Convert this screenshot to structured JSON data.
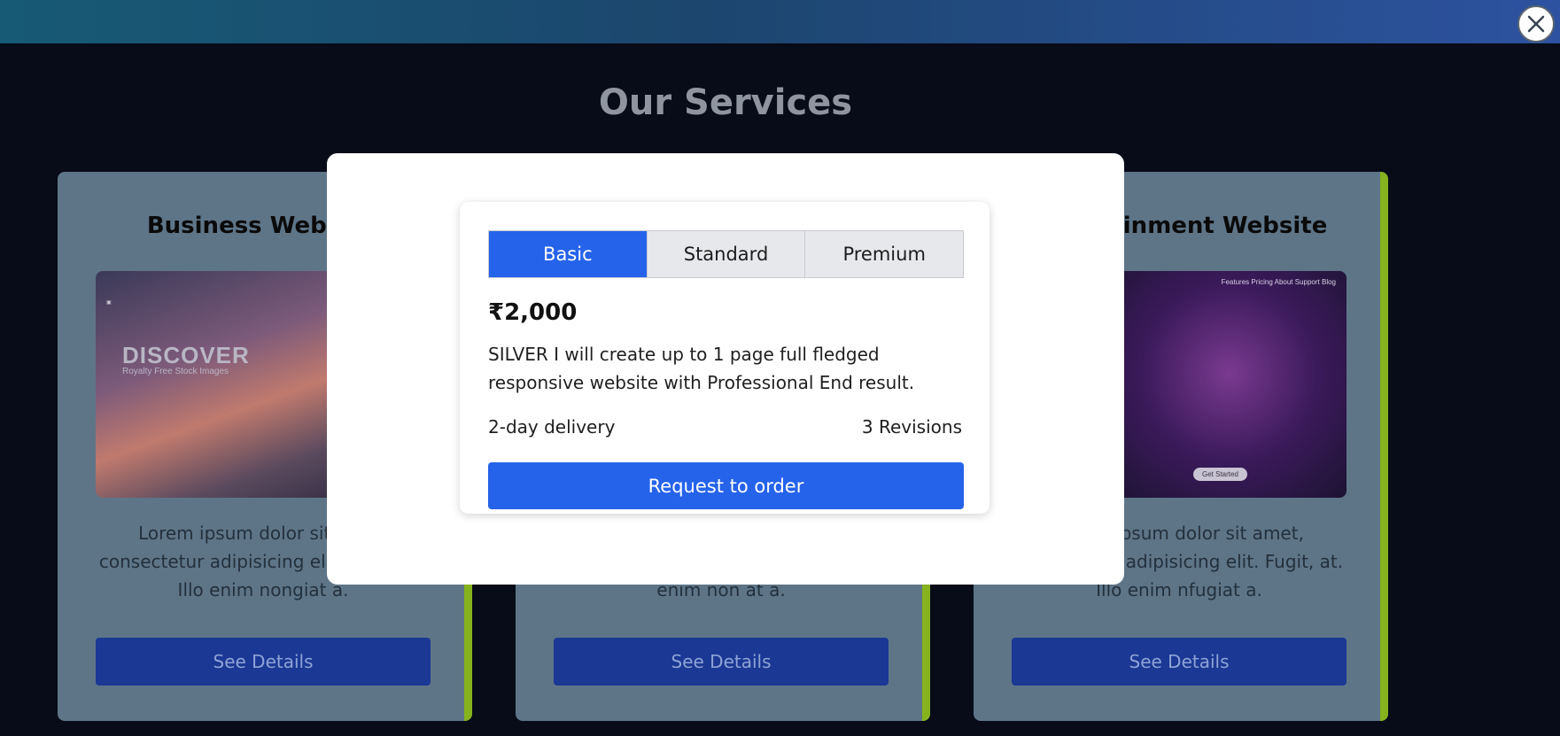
{
  "page": {
    "title": "Our Services"
  },
  "cards": [
    {
      "title": "Business Website",
      "description": "Lorem ipsum dolor sit amet, consectetur adipisicing elit. Fugit, at. Illo enim nongiat a.",
      "image_text": "DISCOVER",
      "image_subtext": "Royalty Free Stock Images",
      "button": "See Details"
    },
    {
      "title": "",
      "description": "enim non at a.",
      "button": "See Details"
    },
    {
      "title": "Entertainment Website",
      "description": "Lorem ipsum dolor sit amet, consectetur adipisicing elit. Fugit, at. Illo enim nfugiat a.",
      "image_nav": "Features  Pricing  About  Support  Blog",
      "image_cta": "Get Started",
      "button": "See Details"
    }
  ],
  "modal": {
    "tabs": [
      {
        "label": "Basic",
        "active": true
      },
      {
        "label": "Standard",
        "active": false
      },
      {
        "label": "Premium",
        "active": false
      }
    ],
    "price": "₹2,000",
    "description": "SILVER I will create up to 1 page full fledged responsive website with Professional End result.",
    "delivery": "2-day delivery",
    "revisions": "3 Revisions",
    "order_button": "Request to order",
    "close_icon": "close-icon"
  },
  "colors": {
    "accent": "#2563eb",
    "card_accent": "#86b21e",
    "see_details": "#1a3894"
  }
}
